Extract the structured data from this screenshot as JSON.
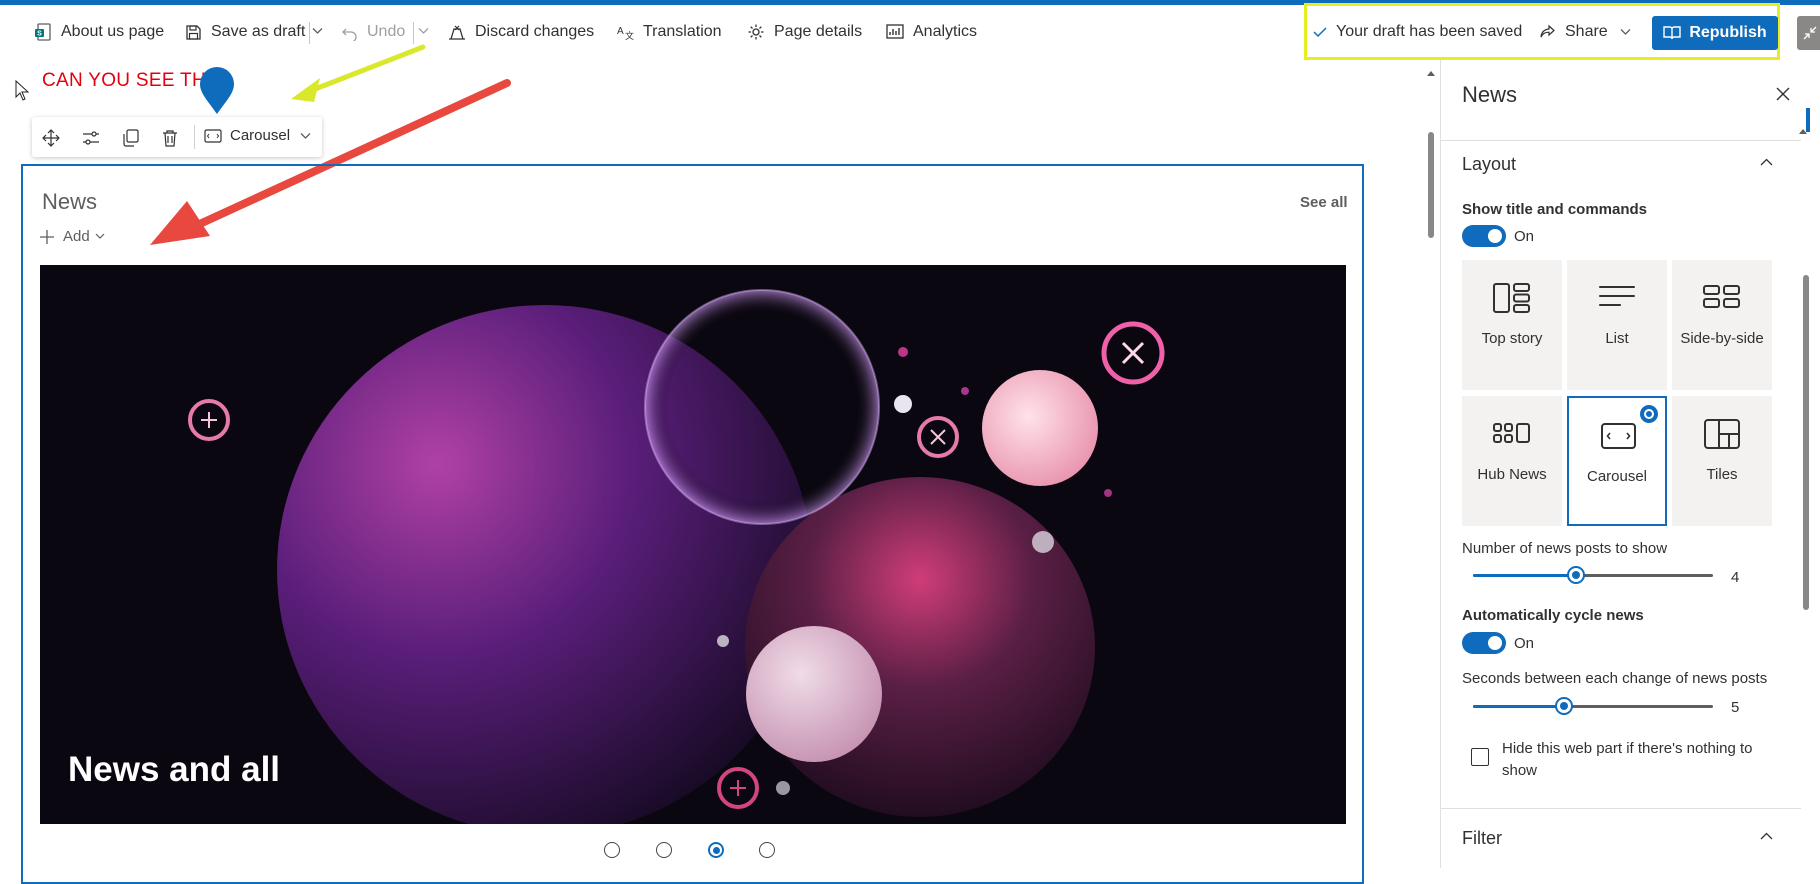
{
  "toolbar": {
    "about_us": "About us page",
    "save_draft": "Save as draft",
    "undo": "Undo",
    "discard": "Discard changes",
    "translation": "Translation",
    "page_details": "Page details",
    "analytics": "Analytics",
    "draft_status": "Your draft has been saved",
    "share": "Share",
    "republish": "Republish"
  },
  "annotation": {
    "text": "CAN YOU SEE THIS"
  },
  "webpart_toolbar": {
    "layout_label": "Carousel"
  },
  "news": {
    "title": "News",
    "see_all": "See all",
    "add": "Add",
    "carousel_title": "News and all",
    "carousel_dots": [
      1,
      2,
      3,
      4
    ],
    "active_dot": 3
  },
  "panel": {
    "title": "News",
    "layout_section": "Layout",
    "show_title_label": "Show title and commands",
    "show_title_state": "On",
    "layouts": [
      "Top story",
      "List",
      "Side-by-side",
      "Hub News",
      "Carousel",
      "Tiles"
    ],
    "selected_layout": "Carousel",
    "num_posts_label": "Number of news posts to show",
    "num_posts_value": "4",
    "num_posts_fraction": 0.43,
    "auto_cycle_label": "Automatically cycle news",
    "auto_cycle_state": "On",
    "seconds_label": "Seconds between each change of news posts",
    "seconds_value": "5",
    "seconds_fraction": 0.38,
    "hide_label": "Hide this web part if there's nothing to show",
    "filter_section": "Filter"
  },
  "colors": {
    "accent": "#0f6cbd",
    "highlight": "#e6ee1e",
    "annotation_red": "#e3000f"
  }
}
